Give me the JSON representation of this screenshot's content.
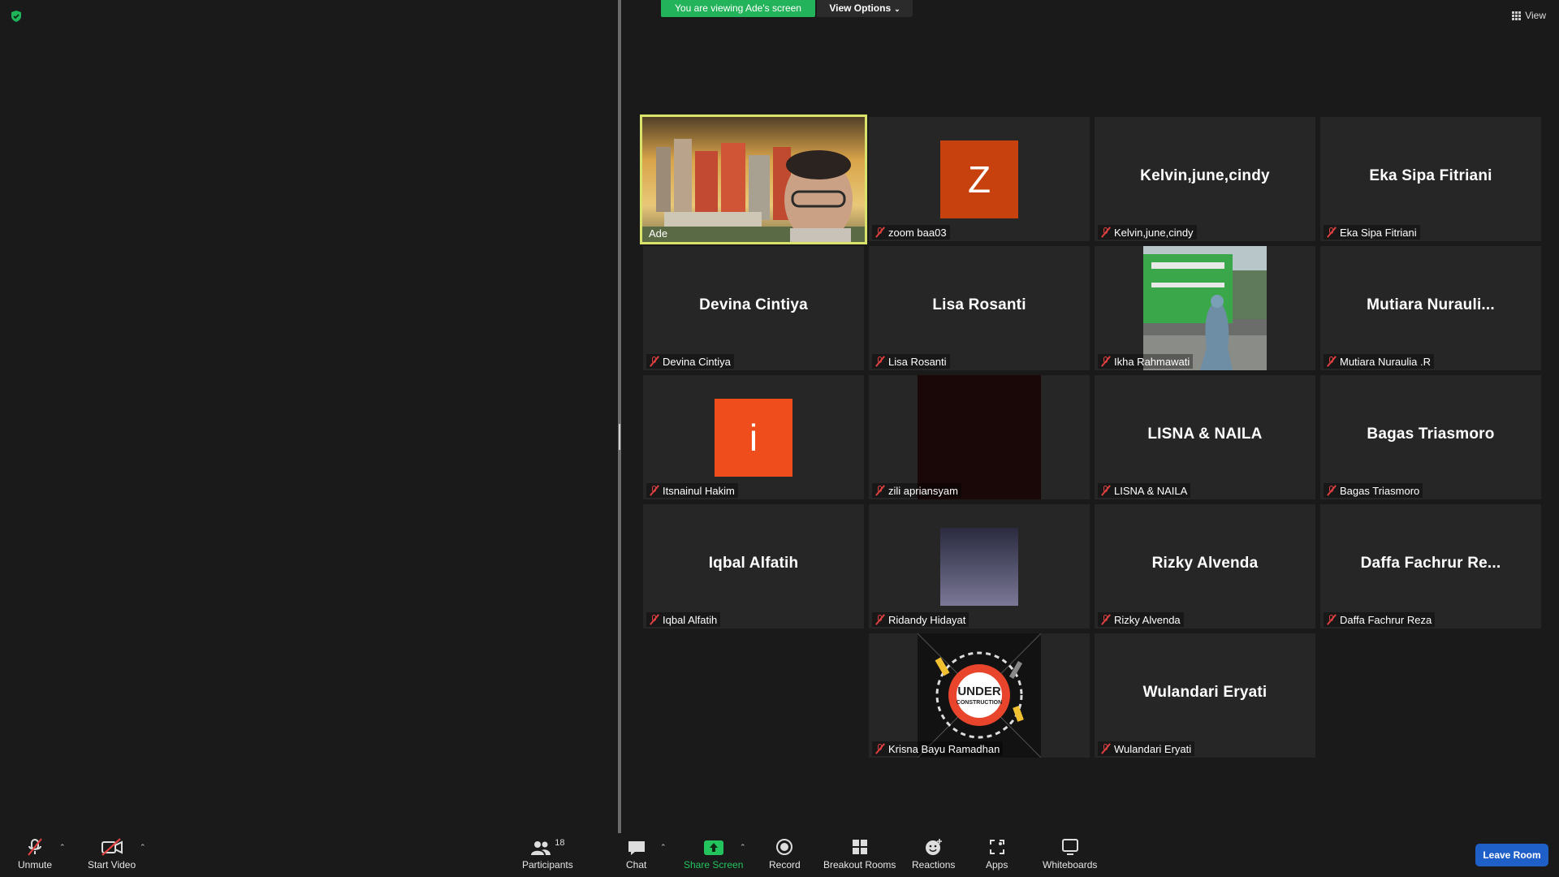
{
  "banner": {
    "viewing": "You are viewing Ade's screen",
    "view_options": "View Options"
  },
  "view_label": "View",
  "tiles": [
    {
      "name": "Ade",
      "label": "Ade",
      "type": "video"
    },
    {
      "name": "zoom baa03",
      "label": "zoom baa03",
      "type": "avatar",
      "letter": "Z",
      "color": "#c6410e"
    },
    {
      "name": "Kelvin,june,cindy",
      "label": "Kelvin,june,cindy",
      "type": "name"
    },
    {
      "name": "Eka Sipa Fitriani",
      "label": "Eka Sipa Fitriani",
      "type": "name"
    },
    {
      "name": "Devina Cintiya",
      "label": "Devina Cintiya",
      "type": "name"
    },
    {
      "name": "Lisa Rosanti",
      "label": "Lisa Rosanti",
      "type": "name"
    },
    {
      "name": "Ikha Rahmawati",
      "label": "Ikha Rahmawati",
      "type": "photo"
    },
    {
      "name": "Mutiara  Nurauli...",
      "label": "Mutiara Nuraulia .R",
      "type": "name"
    },
    {
      "name": "Itsnainul Hakim",
      "label": "Itsnainul Hakim",
      "type": "avatar",
      "letter": "i",
      "color": "#f04d1d"
    },
    {
      "name": "zili apriansyam",
      "label": "zili apriansyam",
      "type": "photo"
    },
    {
      "name": "LISNA & NAILA",
      "label": "LISNA & NAILA",
      "type": "name"
    },
    {
      "name": "Bagas Triasmoro",
      "label": "Bagas Triasmoro",
      "type": "name"
    },
    {
      "name": "Iqbal Alfatih",
      "label": "Iqbal Alfatih",
      "type": "name"
    },
    {
      "name": "Ridandy Hidayat",
      "label": "Ridandy Hidayat",
      "type": "photo"
    },
    {
      "name": "Rizky Alvenda",
      "label": "Rizky Alvenda",
      "type": "name"
    },
    {
      "name": "Daffa  Fachrur  Re...",
      "label": "Daffa Fachrur Reza",
      "type": "name"
    },
    {
      "name": "Krisna Bayu Ramadhan",
      "label": "Krisna Bayu Ramadhan",
      "type": "photo",
      "logo_text_1": "UNDER",
      "logo_text_2": "CONSTRUCTION"
    },
    {
      "name": "Wulandari Eryati",
      "label": "Wulandari Eryati",
      "type": "name"
    }
  ],
  "toolbar": {
    "unmute": "Unmute",
    "start_video": "Start Video",
    "participants": "Participants",
    "participants_count": "18",
    "chat": "Chat",
    "share_screen": "Share Screen",
    "record": "Record",
    "breakout_rooms": "Breakout Rooms",
    "reactions": "Reactions",
    "apps": "Apps",
    "whiteboards": "Whiteboards",
    "leave": "Leave Room"
  },
  "colors": {
    "accent_green": "#23b35a",
    "leave_blue": "#1f5fc8",
    "active_border": "#d9e36b"
  }
}
